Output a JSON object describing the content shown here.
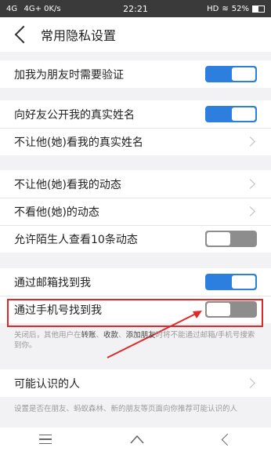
{
  "status_bar": {
    "network": "4G   4G+ ",
    "speed": "0K/s",
    "time": "22:21",
    "hd": "HD",
    "battery": "52%"
  },
  "header": {
    "title": "常用隐私设置"
  },
  "groups": [
    {
      "items": [
        {
          "label": "加我为朋友时需要验证",
          "control": "toggle",
          "on": true
        }
      ]
    },
    {
      "items": [
        {
          "label": "向好友公开我的真实姓名",
          "control": "toggle",
          "on": true
        },
        {
          "label": "不让他(她)看我的真实姓名",
          "control": "chevron"
        }
      ]
    },
    {
      "items": [
        {
          "label": "不让他(她)看我的动态",
          "control": "chevron"
        },
        {
          "label": "不看他(她)的动态",
          "control": "chevron"
        },
        {
          "label": "允许陌生人查看10条动态",
          "control": "toggle",
          "on": false
        }
      ]
    },
    {
      "items": [
        {
          "label": "通过邮箱找到我",
          "control": "toggle",
          "on": true
        },
        {
          "label": "通过手机号找到我",
          "control": "toggle",
          "on": false
        }
      ]
    },
    {
      "items": [
        {
          "label": "可能认识的人",
          "control": "chevron"
        }
      ]
    }
  ],
  "notes": {
    "find_me_prefix": "关闭后，其他用户在",
    "find_me_k1": "转账",
    "find_me_sep1": "、",
    "find_me_k2": "收款",
    "find_me_sep2": "、",
    "find_me_k3": "添加朋友",
    "find_me_suffix": "时将不能通过邮箱/手机号搜索到你。",
    "people_you_may_know": "设置是否在朋友、蚂蚁森林、新的朋友等页面向你推荐可能认识的人"
  },
  "colors": {
    "toggle_on": "#2c7fde",
    "toggle_off": "#8d8d8d",
    "highlight": "#e12828"
  },
  "icons": {
    "back": "chevron-left-icon",
    "row_arrow": "chevron-right-icon",
    "nav": [
      "menu-icon",
      "home-icon",
      "back-icon"
    ]
  }
}
